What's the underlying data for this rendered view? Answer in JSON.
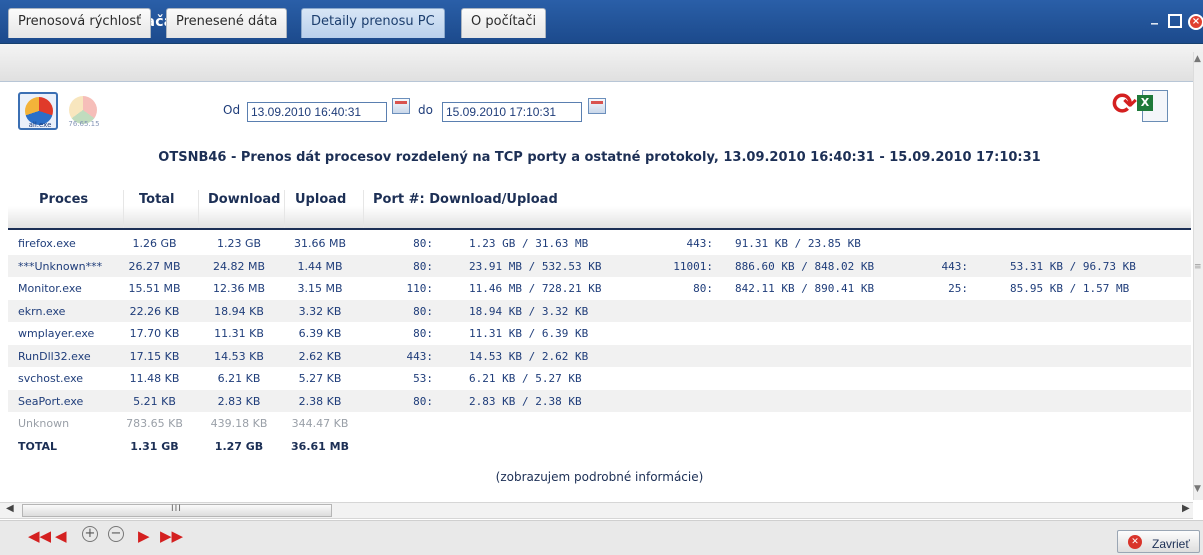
{
  "window": {
    "title": "Detail počítača OTSNB46.",
    "app_icon": "c-logo-icon",
    "controls": {
      "minimize": "_",
      "close": "×"
    }
  },
  "tabs": [
    {
      "label": "Prenosová rýchlosť",
      "active": false
    },
    {
      "label": "Prenesené dáta",
      "active": false
    },
    {
      "label": "Detaily prenosu PC",
      "active": true
    },
    {
      "label": "O počítači",
      "active": false
    }
  ],
  "toolbar": {
    "process_icons": [
      {
        "label": "all.exe"
      },
      {
        "label": "76.65.15"
      }
    ],
    "from_label": "Od",
    "from_value": "13.09.2010 16:40:31",
    "to_label": "do",
    "to_value": "15.09.2010 17:10:31",
    "refresh_icon": "refresh-icon",
    "export_icon": "excel-export-icon"
  },
  "report": {
    "title": "OTSNB46 - Prenos dát procesov rozdelený na TCP porty a ostatné protokoly, 13.09.2010 16:40:31 - 15.09.2010 17:10:31",
    "columns": {
      "process": "Proces",
      "total": "Total",
      "download": "Download",
      "upload": "Upload",
      "ports": "Port #: Download/Upload"
    },
    "rows": [
      {
        "process": "firefox.exe",
        "total": "1.26 GB",
        "download": "1.23 GB",
        "upload": "31.66 MB",
        "ports": [
          {
            "port": "80:",
            "value": "1.23 GB / 31.63 MB"
          },
          {
            "port": "443:",
            "value": "91.31 KB / 23.85 KB"
          }
        ]
      },
      {
        "process": "***Unknown***",
        "total": "26.27 MB",
        "download": "24.82 MB",
        "upload": "1.44 MB",
        "ports": [
          {
            "port": "80:",
            "value": "23.91 MB / 532.53 KB"
          },
          {
            "port": "11001:",
            "value": "886.60 KB / 848.02 KB"
          },
          {
            "port": "443:",
            "value": "53.31 KB / 96.73 KB"
          }
        ]
      },
      {
        "process": "Monitor.exe",
        "total": "15.51 MB",
        "download": "12.36 MB",
        "upload": "3.15 MB",
        "ports": [
          {
            "port": "110:",
            "value": "11.46 MB / 728.21 KB"
          },
          {
            "port": "80:",
            "value": "842.11 KB / 890.41 KB"
          },
          {
            "port": "25:",
            "value": "85.95 KB / 1.57 MB"
          }
        ]
      },
      {
        "process": "ekrn.exe",
        "total": "22.26 KB",
        "download": "18.94 KB",
        "upload": "3.32 KB",
        "ports": [
          {
            "port": "80:",
            "value": "18.94 KB / 3.32 KB"
          }
        ]
      },
      {
        "process": "wmplayer.exe",
        "total": "17.70 KB",
        "download": "11.31 KB",
        "upload": "6.39 KB",
        "ports": [
          {
            "port": "80:",
            "value": "11.31 KB / 6.39 KB"
          }
        ]
      },
      {
        "process": "RunDll32.exe",
        "total": "17.15 KB",
        "download": "14.53 KB",
        "upload": "2.62 KB",
        "ports": [
          {
            "port": "443:",
            "value": "14.53 KB / 2.62 KB"
          }
        ]
      },
      {
        "process": "svchost.exe",
        "total": "11.48 KB",
        "download": "6.21 KB",
        "upload": "5.27 KB",
        "ports": [
          {
            "port": "53:",
            "value": "6.21 KB / 5.27 KB"
          }
        ]
      },
      {
        "process": "SeaPort.exe",
        "total": "5.21 KB",
        "download": "2.83 KB",
        "upload": "2.38 KB",
        "ports": [
          {
            "port": "80:",
            "value": "2.83 KB / 2.38 KB"
          }
        ]
      }
    ],
    "unknown_row": {
      "process": "Unknown",
      "total": "783.65 KB",
      "download": "439.18 KB",
      "upload": "344.47 KB"
    },
    "total_row": {
      "process": "TOTAL",
      "total": "1.31 GB",
      "download": "1.27 GB",
      "upload": "36.61 MB"
    },
    "status_note": "(zobrazujem podrobné informácie)"
  },
  "footer": {
    "nav_icons": [
      "first-arrow-icon",
      "prev-arrow-icon",
      "zoom-in-icon",
      "zoom-out-icon",
      "next-arrow-icon",
      "last-arrow-icon"
    ],
    "close_label": "Zavrieť"
  }
}
